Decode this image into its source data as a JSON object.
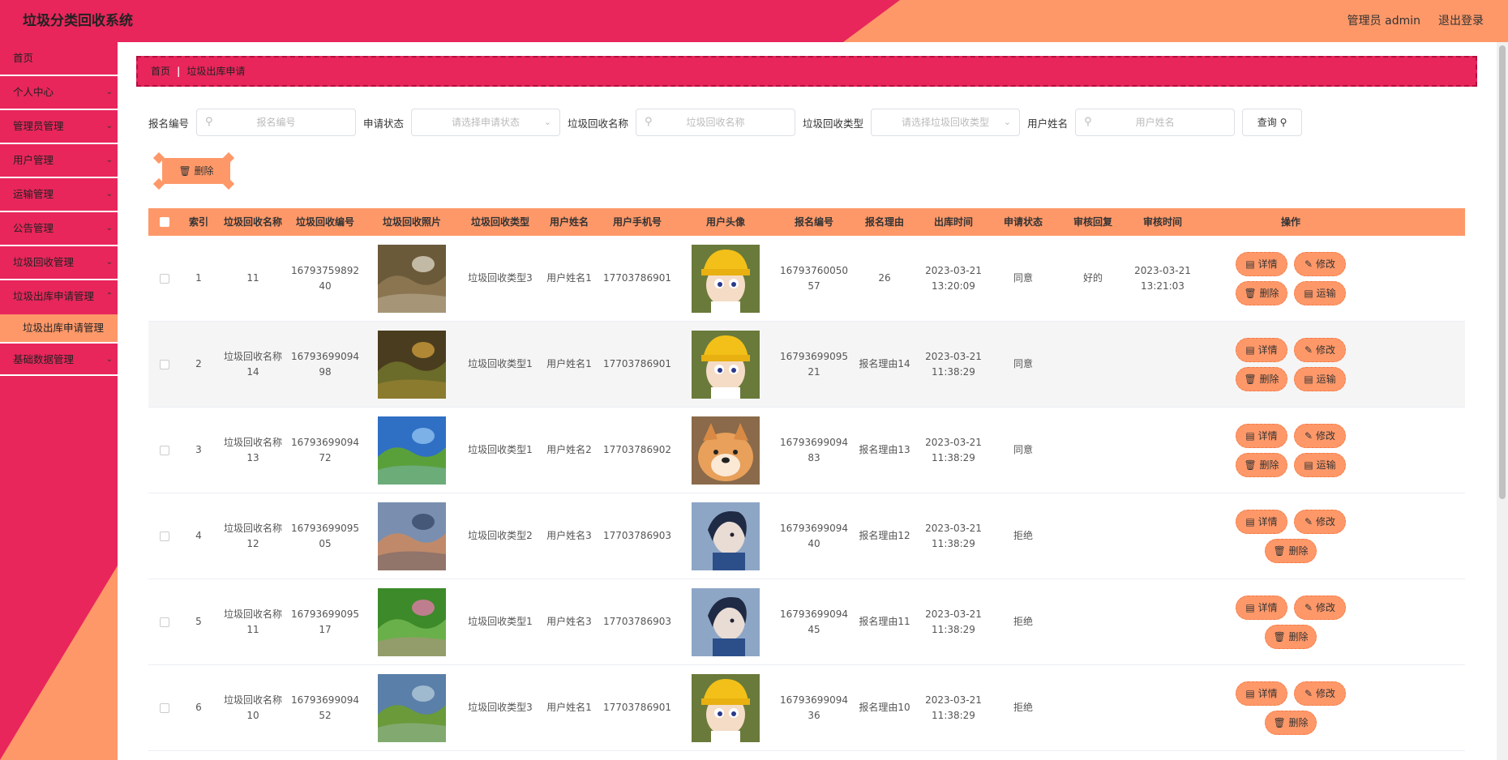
{
  "app": {
    "title": "垃圾分类回收系统",
    "user_label": "管理员 admin",
    "logout_label": "退出登录"
  },
  "sidebar": {
    "items": [
      {
        "label": "首页"
      },
      {
        "label": "个人中心"
      },
      {
        "label": "管理员管理"
      },
      {
        "label": "用户管理"
      },
      {
        "label": "运输管理"
      },
      {
        "label": "公告管理"
      },
      {
        "label": "垃圾回收管理"
      },
      {
        "label": "垃圾出库申请管理"
      },
      {
        "label": "垃圾出库申请管理"
      },
      {
        "label": "基础数据管理"
      }
    ]
  },
  "breadcrumb": {
    "home": "首页",
    "current": "垃圾出库申请"
  },
  "search": {
    "f1_label": "报名编号",
    "f1_placeholder": "报名编号",
    "f2_label": "申请状态",
    "f2_placeholder": "请选择申请状态",
    "f3_label": "垃圾回收名称",
    "f3_placeholder": "垃圾回收名称",
    "f4_label": "垃圾回收类型",
    "f4_placeholder": "请选择垃圾回收类型",
    "f5_label": "用户姓名",
    "f5_placeholder": "用户姓名",
    "query_label": "查询"
  },
  "batch_delete_label": "删除",
  "table": {
    "headers": [
      "索引",
      "垃圾回收名称",
      "垃圾回收编号",
      "垃圾回收照片",
      "垃圾回收类型",
      "用户姓名",
      "用户手机号",
      "用户头像",
      "报名编号",
      "报名理由",
      "出库时间",
      "申请状态",
      "审核回复",
      "审核时间",
      "操作"
    ],
    "op_labels": {
      "detail": "详情",
      "edit": "修改",
      "delete": "删除",
      "transport": "运输"
    },
    "rows": [
      {
        "index": "1",
        "name": "11",
        "code": "1679375989240",
        "type": "垃圾回收类型3",
        "user": "用户姓名1",
        "phone": "17703786901",
        "apply_no": "1679376005057",
        "reason": "26",
        "out_time": "2023-03-21 13:20:09",
        "status": "同意",
        "reply": "好的",
        "review_time": "2023-03-21 13:21:03",
        "transport": true
      },
      {
        "index": "2",
        "name": "垃圾回收名称14",
        "code": "1679369909498",
        "type": "垃圾回收类型1",
        "user": "用户姓名1",
        "phone": "17703786901",
        "apply_no": "1679369909521",
        "reason": "报名理由14",
        "out_time": "2023-03-21 11:38:29",
        "status": "同意",
        "reply": "",
        "review_time": "",
        "transport": true
      },
      {
        "index": "3",
        "name": "垃圾回收名称13",
        "code": "1679369909472",
        "type": "垃圾回收类型1",
        "user": "用户姓名2",
        "phone": "17703786902",
        "apply_no": "1679369909483",
        "reason": "报名理由13",
        "out_time": "2023-03-21 11:38:29",
        "status": "同意",
        "reply": "",
        "review_time": "",
        "transport": true
      },
      {
        "index": "4",
        "name": "垃圾回收名称12",
        "code": "1679369909505",
        "type": "垃圾回收类型2",
        "user": "用户姓名3",
        "phone": "17703786903",
        "apply_no": "1679369909440",
        "reason": "报名理由12",
        "out_time": "2023-03-21 11:38:29",
        "status": "拒绝",
        "reply": "",
        "review_time": "",
        "transport": false
      },
      {
        "index": "5",
        "name": "垃圾回收名称11",
        "code": "1679369909517",
        "type": "垃圾回收类型1",
        "user": "用户姓名3",
        "phone": "17703786903",
        "apply_no": "1679369909445",
        "reason": "报名理由11",
        "out_time": "2023-03-21 11:38:29",
        "status": "拒绝",
        "reply": "",
        "review_time": "",
        "transport": false
      },
      {
        "index": "6",
        "name": "垃圾回收名称10",
        "code": "1679369909452",
        "type": "垃圾回收类型3",
        "user": "用户姓名1",
        "phone": "17703786901",
        "apply_no": "1679369909436",
        "reason": "报名理由10",
        "out_time": "2023-03-21 11:38:29",
        "status": "拒绝",
        "reply": "",
        "review_time": "",
        "transport": false
      }
    ]
  },
  "colors": {
    "primary": "#e8265b",
    "accent": "#fe9869"
  }
}
